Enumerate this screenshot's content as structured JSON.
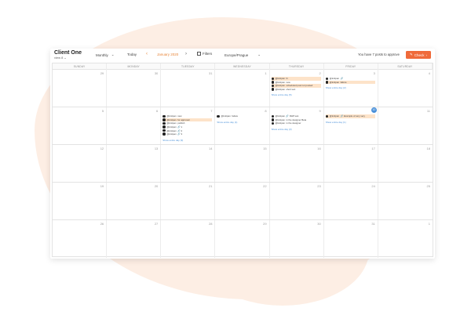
{
  "header": {
    "client_name": "Client One",
    "client_sub": "view 8",
    "view_mode": "Monthly",
    "today_label": "Today",
    "month_label": "January 2020",
    "filters_label": "Filters",
    "timezone": "Europe/Prague",
    "notice": "You have 7 posts to approve",
    "check_label": "Check"
  },
  "weekdays": [
    "SUNDAY",
    "MONDAY",
    "TUESDAY",
    "WEDNESDAY",
    "THURSDAY",
    "FRIDAY",
    "SATURDAY"
  ],
  "weeks": [
    [
      {
        "num": "29",
        "posts": []
      },
      {
        "num": "30",
        "posts": []
      },
      {
        "num": "31",
        "posts": []
      },
      {
        "num": "1",
        "posts": []
      },
      {
        "num": "2",
        "posts": [
          {
            "author": "@knitpan",
            "text": "hi",
            "hl": true
          },
          {
            "author": "@knitpan",
            "text": "new",
            "hl": false
          },
          {
            "author": "@knitpan",
            "text": "scheduled post not posted",
            "hl": true
          },
          {
            "author": "@knitpan",
            "text": "short text",
            "hl": false
          }
        ],
        "more": "Show entire day (5)"
      },
      {
        "num": "3",
        "posts": [
          {
            "author": "@knitpan",
            "text": "🔗",
            "hl": false
          },
          {
            "author": "@knitpan",
            "text": "failure",
            "hl": true
          }
        ],
        "more": "Show entire day (2)"
      },
      {
        "num": "4",
        "posts": []
      }
    ],
    [
      {
        "num": "5",
        "posts": []
      },
      {
        "num": "6",
        "posts": []
      },
      {
        "num": "7",
        "posts": [
          {
            "author": "@knitpan",
            "text": "new",
            "hl": false
          },
          {
            "author": "@knitpan",
            "text": "for approval",
            "hl": true
          },
          {
            "author": "@knitpan",
            "text": "publish",
            "hl": false
          },
          {
            "author": "@knitpan",
            "text": "🔗 1",
            "hl": false
          },
          {
            "author": "@knitpan",
            "text": "🔗 2",
            "hl": false
          },
          {
            "author": "@knitpan",
            "text": "🔗 3",
            "hl": false
          }
        ],
        "more": "Show entire day (9)"
      },
      {
        "num": "8",
        "posts": [
          {
            "author": "@knitpan",
            "text": "failure",
            "hl": false
          }
        ],
        "more": "Show entire day (1)"
      },
      {
        "num": "9",
        "posts": [
          {
            "author": "@knitpan",
            "text": "🔗 RHP test",
            "hl": false
          },
          {
            "author": "@knitpan",
            "text": "in the designer Beta",
            "hl": false
          },
          {
            "author": "@knitpan",
            "text": "in the designer",
            "hl": false
          }
        ],
        "more": "Show entire day (3)"
      },
      {
        "num": "10",
        "today": true,
        "posts": [
          {
            "author": "@knitpan",
            "text": "🔗 Example of very very",
            "hl": true
          }
        ],
        "more": "Show entire day (1)"
      },
      {
        "num": "11",
        "posts": []
      }
    ],
    [
      {
        "num": "12",
        "posts": []
      },
      {
        "num": "13",
        "posts": []
      },
      {
        "num": "14",
        "posts": []
      },
      {
        "num": "15",
        "posts": []
      },
      {
        "num": "16",
        "posts": []
      },
      {
        "num": "17",
        "posts": []
      },
      {
        "num": "18",
        "posts": []
      }
    ],
    [
      {
        "num": "19",
        "posts": []
      },
      {
        "num": "20",
        "posts": []
      },
      {
        "num": "21",
        "posts": []
      },
      {
        "num": "22",
        "posts": []
      },
      {
        "num": "23",
        "posts": []
      },
      {
        "num": "24",
        "posts": []
      },
      {
        "num": "25",
        "posts": []
      }
    ],
    [
      {
        "num": "26",
        "posts": []
      },
      {
        "num": "27",
        "posts": []
      },
      {
        "num": "28",
        "posts": []
      },
      {
        "num": "29",
        "posts": []
      },
      {
        "num": "30",
        "posts": []
      },
      {
        "num": "31",
        "posts": []
      },
      {
        "num": "1",
        "posts": []
      }
    ]
  ],
  "colors": {
    "accent": "#ef6a3a",
    "month": "#e8863a",
    "highlight": "#fde3c9",
    "link": "#4a90d9",
    "background_blob": "#fdeee4"
  },
  "icons": {
    "prev": "chevron-left-icon",
    "next": "chevron-right-icon",
    "filter": "filter-icon",
    "check": "check-icon",
    "dropdown": "chevron-down-icon"
  }
}
